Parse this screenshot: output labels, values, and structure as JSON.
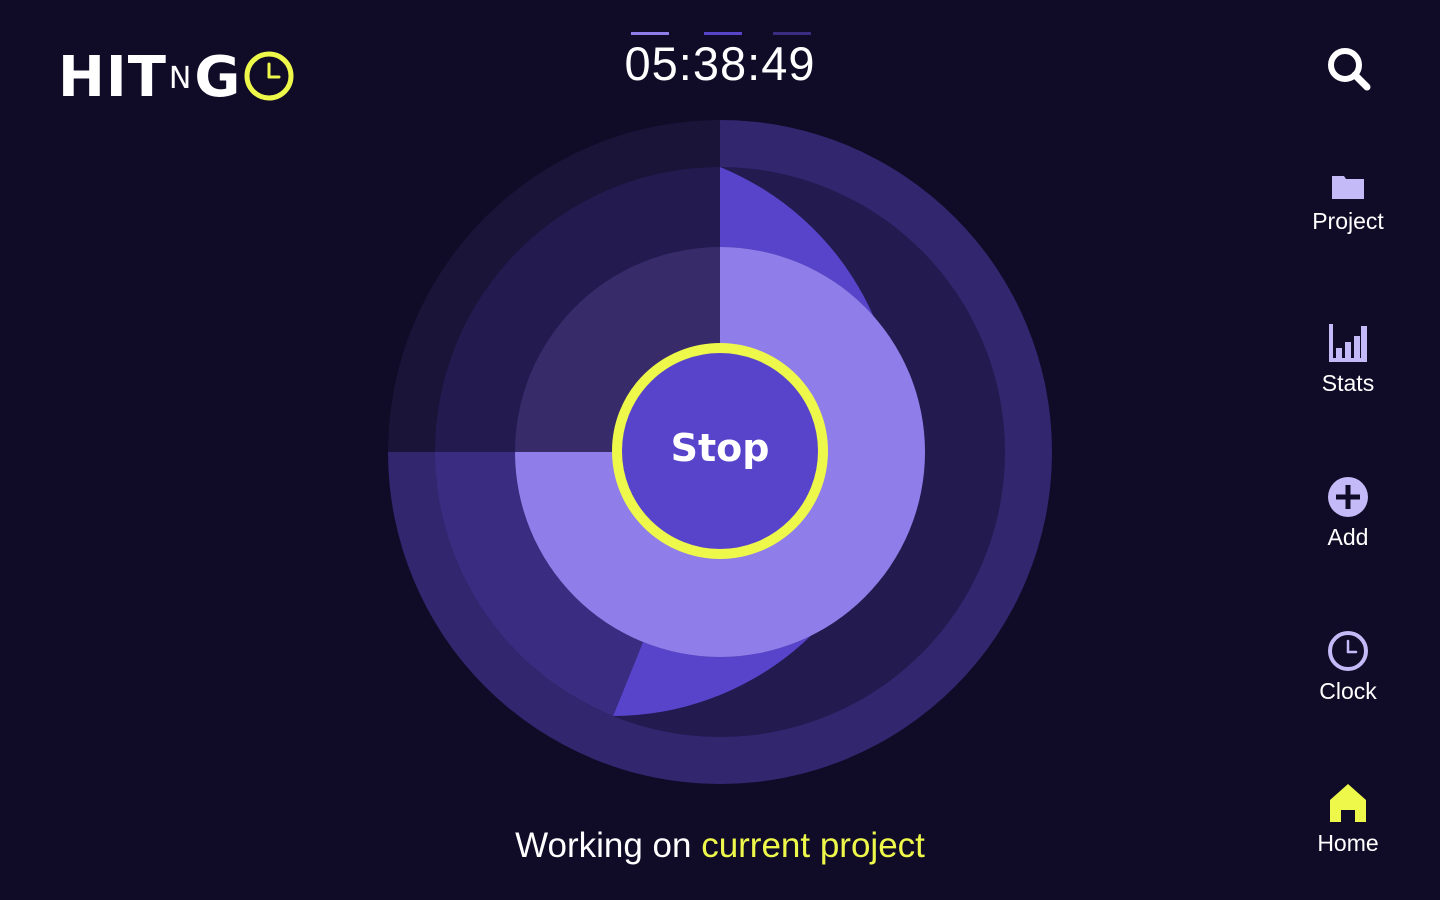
{
  "app": {
    "logo": {
      "part1": "HIT",
      "part2": "N",
      "part3": "G"
    }
  },
  "timer": {
    "value": "05:38:49"
  },
  "stop_button": {
    "label": "Stop"
  },
  "status": {
    "prefix": "Working on ",
    "highlight": "current project"
  },
  "nav": {
    "items": [
      {
        "id": "project",
        "label": "Project",
        "icon": "folder-icon"
      },
      {
        "id": "stats",
        "label": "Stats",
        "icon": "bar-chart-icon"
      },
      {
        "id": "add",
        "label": "Add",
        "icon": "plus-circle-icon"
      },
      {
        "id": "clock",
        "label": "Clock",
        "icon": "clock-icon"
      },
      {
        "id": "home",
        "label": "Home",
        "icon": "home-icon",
        "active": true
      }
    ]
  },
  "colors": {
    "background": "#100b27",
    "accent": "#eef84a",
    "primary": "#5844cb",
    "light": "#8f7ee9",
    "nav_icon": "#c4baf7"
  }
}
